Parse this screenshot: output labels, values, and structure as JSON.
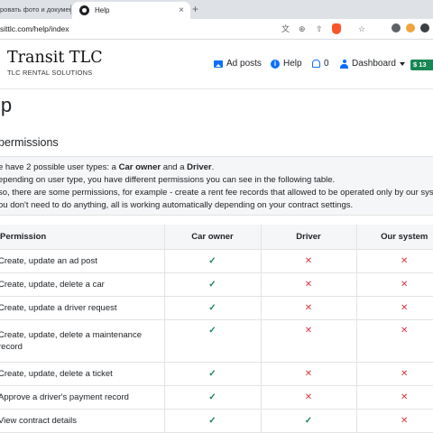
{
  "browser": {
    "inactive_tab_title": "ровать фото и документ",
    "active_tab_title": "Help",
    "close_glyph": "×",
    "new_tab_glyph": "+",
    "url": "sittlc.com/help/index"
  },
  "navbar": {
    "brand_title": "Transit TLC",
    "brand_subtitle": "TLC RENTAL SOLUTIONS",
    "ad_posts": "Ad posts",
    "help": "Help",
    "notifications_count": "0",
    "dashboard": "Dashboard",
    "balance": "$ 13"
  },
  "page": {
    "title": "lp",
    "section_title": "permissions",
    "info_lines": [
      {
        "pre": "e have 2 possible user types: a ",
        "b1": "Car owner",
        "mid": " and a ",
        "b2": "Driver",
        "post": "."
      },
      "epending on user type, you have different permissions you can see in the following table.",
      "so, there are some permissions, for example - create a rent fee records that allowed to be operated only by our system.",
      "ou don't need to do anything, all is working automatically depending on your contract settings."
    ]
  },
  "table": {
    "headers": [
      "Permission",
      "Car owner",
      "Driver",
      "Our system"
    ],
    "rows": [
      {
        "name": "Create, update an ad post",
        "car_owner": "✓",
        "driver": "✕",
        "system": "✕"
      },
      {
        "name": "Create, update, delete a car",
        "car_owner": "✓",
        "driver": "✕",
        "system": "✕"
      },
      {
        "name": "Create, update a driver request",
        "car_owner": "✓",
        "driver": "✕",
        "system": "✕"
      },
      {
        "name": "Create, update, delete a maintenance record",
        "car_owner": "✓",
        "driver": "✕",
        "system": "✕"
      },
      {
        "name": "Create, update, delete a ticket",
        "car_owner": "✓",
        "driver": "✕",
        "system": "✕"
      },
      {
        "name": "Approve a driver's payment record",
        "car_owner": "✓",
        "driver": "✕",
        "system": "✕"
      },
      {
        "name": "View contract details",
        "car_owner": "✓",
        "driver": "✓",
        "system": "✕"
      }
    ]
  },
  "colors": {
    "accent": "#0d6efd",
    "check": "#198754",
    "cross": "#dc3545",
    "badge": "#198754"
  }
}
